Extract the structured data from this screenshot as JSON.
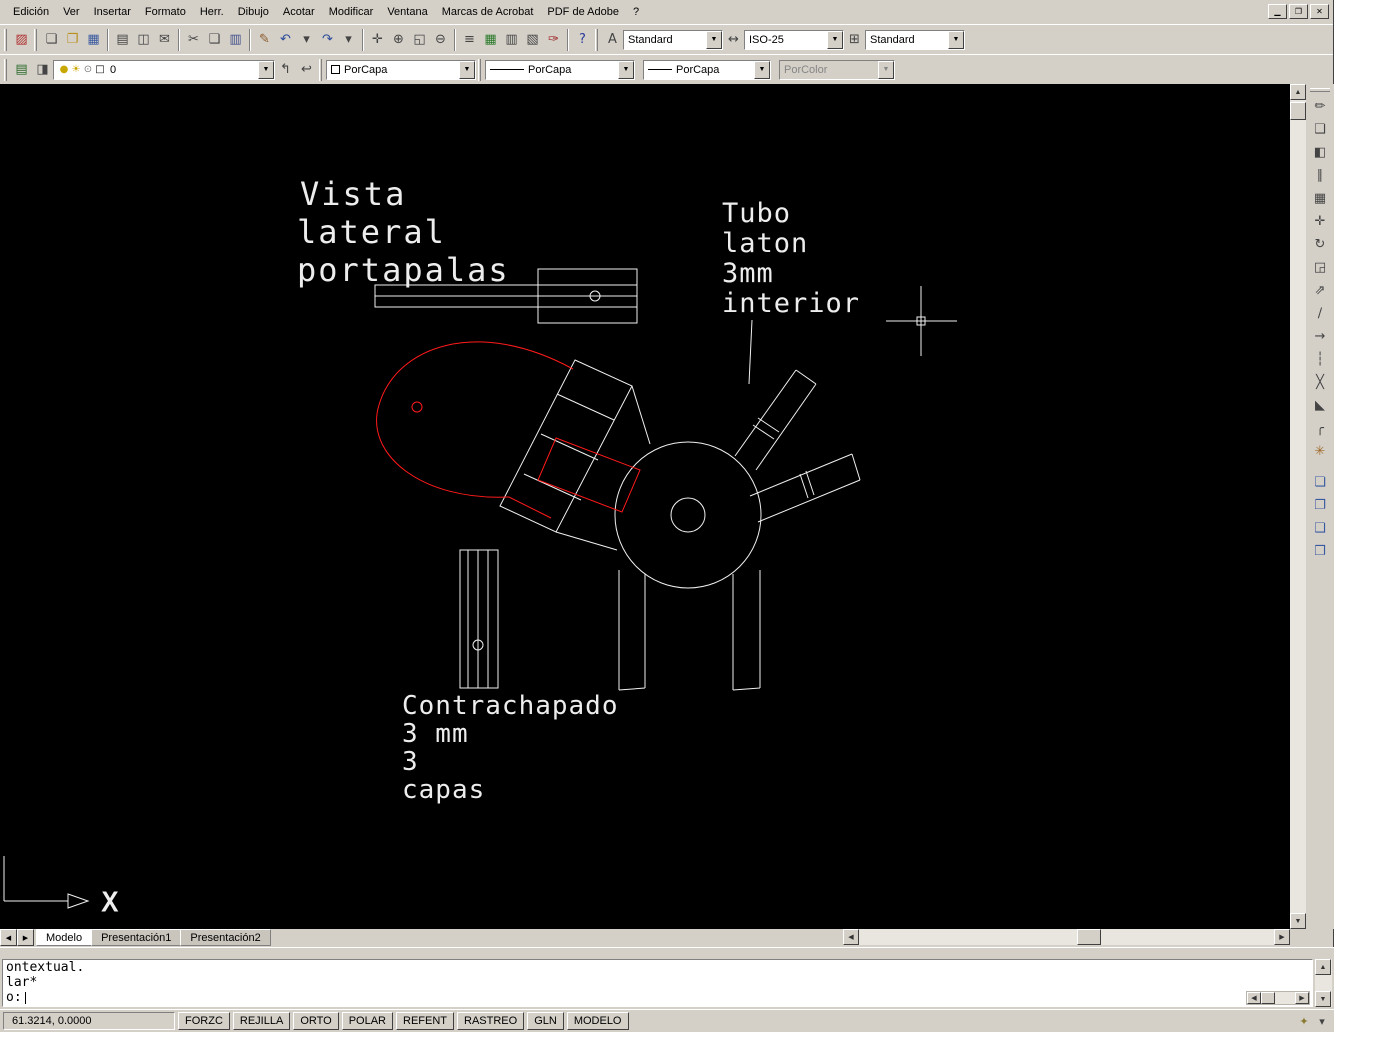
{
  "menu_bar": {
    "items": [
      {
        "name": "menu-edicion",
        "label": "Edición"
      },
      {
        "name": "menu-ver",
        "label": "Ver"
      },
      {
        "name": "menu-insertar",
        "label": "Insertar"
      },
      {
        "name": "menu-formato",
        "label": "Formato"
      },
      {
        "name": "menu-herr",
        "label": "Herr."
      },
      {
        "name": "menu-dibujo",
        "label": "Dibujo"
      },
      {
        "name": "menu-acotar",
        "label": "Acotar"
      },
      {
        "name": "menu-modificar",
        "label": "Modificar"
      },
      {
        "name": "menu-ventana",
        "label": "Ventana"
      },
      {
        "name": "menu-marcas-de-acrobat",
        "label": "Marcas de Acrobat"
      },
      {
        "name": "menu-pdf-de-adobe",
        "label": "PDF de Adobe"
      },
      {
        "name": "menu-ayuda",
        "label": "?"
      }
    ],
    "window_controls": [
      {
        "name": "minimize-button",
        "glyph": "▁"
      },
      {
        "name": "restore-button",
        "glyph": "❐"
      },
      {
        "name": "close-button",
        "glyph": "✕"
      }
    ]
  },
  "toolbar_standard": {
    "groups": [
      [
        {
          "name": "app-icon",
          "glyph": "▨",
          "color": "#b03030"
        }
      ],
      [
        {
          "name": "new-icon",
          "glyph": "❏",
          "color": "#444"
        },
        {
          "name": "open-icon",
          "glyph": "❐",
          "color": "#b8901c"
        },
        {
          "name": "save-icon",
          "glyph": "▦",
          "color": "#3a5aa0"
        }
      ],
      [
        {
          "name": "plot-icon",
          "glyph": "▤",
          "color": "#444"
        },
        {
          "name": "plot-preview-icon",
          "glyph": "◫",
          "color": "#444"
        },
        {
          "name": "publish-icon",
          "glyph": "✉",
          "color": "#444"
        }
      ],
      [
        {
          "name": "cut-icon",
          "glyph": "✂",
          "color": "#444"
        },
        {
          "name": "copy-icon",
          "glyph": "❑",
          "color": "#444"
        },
        {
          "name": "paste-icon",
          "glyph": "▥",
          "color": "#44508a"
        }
      ],
      [
        {
          "name": "match-properties-icon",
          "glyph": "✎",
          "color": "#8a5a2a"
        },
        {
          "name": "undo-icon",
          "glyph": "↶",
          "color": "#2a4a9a"
        },
        {
          "name": "undo-history-arrow-icon",
          "glyph": "▾",
          "color": "#444"
        },
        {
          "name": "redo-icon",
          "glyph": "↷",
          "color": "#2a4a9a"
        },
        {
          "name": "redo-history-arrow-icon",
          "glyph": "▾",
          "color": "#444"
        }
      ],
      [
        {
          "name": "pan-realtime-icon",
          "glyph": "✛",
          "color": "#444"
        },
        {
          "name": "zoom-realtime-icon",
          "glyph": "⊕",
          "color": "#444"
        },
        {
          "name": "zoom-window-icon",
          "glyph": "◱",
          "color": "#444"
        },
        {
          "name": "zoom-previous-icon",
          "glyph": "⊖",
          "color": "#444"
        }
      ],
      [
        {
          "name": "properties-icon",
          "glyph": "≡",
          "color": "#444"
        },
        {
          "name": "designcenter-icon",
          "glyph": "▦",
          "color": "#2a7a2a"
        },
        {
          "name": "tool-palettes-icon",
          "glyph": "▥",
          "color": "#444"
        },
        {
          "name": "sheetset-manager-icon",
          "glyph": "▧",
          "color": "#444"
        },
        {
          "name": "markup-icon",
          "glyph": "✑",
          "color": "#a02a2a"
        }
      ],
      [
        {
          "name": "help-icon",
          "glyph": "?",
          "color": "#2a3a9a"
        }
      ]
    ]
  },
  "toolbar_styles": {
    "icons": [
      {
        "name": "text-style-icon",
        "glyph": "A",
        "color": "#444"
      },
      {
        "name": "dim-style-icon",
        "glyph": "↔",
        "color": "#444"
      },
      {
        "name": "table-style-icon",
        "glyph": "⊞",
        "color": "#444"
      }
    ],
    "text_style_value": "Standard",
    "dim_style_value": "ISO-25",
    "table_style_value": "Standard"
  },
  "toolbar_layers": {
    "pre_icons": [
      {
        "name": "layer-properties-icon",
        "glyph": "▤",
        "color": "#2a6a2a"
      },
      {
        "name": "layer-states-icon",
        "glyph": "◨",
        "color": "#444"
      }
    ],
    "layer_combo": {
      "icons": [
        {
          "name": "layer-on-bulb-icon",
          "glyph": "●",
          "color": "#c8a800"
        },
        {
          "name": "layer-thaw-sun-icon",
          "glyph": "☀",
          "color": "#c8a800"
        },
        {
          "name": "layer-lock-icon",
          "glyph": "⊙",
          "color": "#777"
        },
        {
          "name": "layer-color-swatch-icon",
          "glyph": "□",
          "color": "#000"
        }
      ],
      "value": "0"
    },
    "post_icons": [
      {
        "name": "make-object-layer-current-icon",
        "glyph": "↰",
        "color": "#444"
      },
      {
        "name": "layer-previous-icon",
        "glyph": "↩",
        "color": "#444"
      }
    ],
    "color_value": "PorCapa",
    "linetype_value": "PorCapa",
    "lineweight_value": "PorCapa",
    "plot_style_value": "PorColor"
  },
  "side_toolbar": {
    "modify_icons": [
      {
        "name": "erase-icon",
        "glyph": "✏",
        "color": "#444"
      },
      {
        "name": "copy-object-icon",
        "glyph": "❑",
        "color": "#444"
      },
      {
        "name": "mirror-icon",
        "glyph": "◧",
        "color": "#444"
      },
      {
        "name": "offset-icon",
        "glyph": "∥",
        "color": "#444"
      },
      {
        "name": "array-icon",
        "glyph": "▦",
        "color": "#444"
      },
      {
        "name": "move-icon",
        "glyph": "✛",
        "color": "#444"
      },
      {
        "name": "rotate-icon",
        "glyph": "↻",
        "color": "#444"
      },
      {
        "name": "scale-icon",
        "glyph": "◲",
        "color": "#444"
      },
      {
        "name": "stretch-icon",
        "glyph": "⇗",
        "color": "#444"
      },
      {
        "name": "trim-icon",
        "glyph": "∕",
        "color": "#444"
      },
      {
        "name": "extend-icon",
        "glyph": "→",
        "color": "#444"
      },
      {
        "name": "break-at-point-icon",
        "glyph": "┆",
        "color": "#444"
      },
      {
        "name": "break-icon",
        "glyph": "╳",
        "color": "#444"
      },
      {
        "name": "chamfer-icon",
        "glyph": "◣",
        "color": "#444"
      },
      {
        "name": "fillet-icon",
        "glyph": "╭",
        "color": "#444"
      },
      {
        "name": "explode-icon",
        "glyph": "✳",
        "color": "#a06a2a"
      }
    ],
    "draworder_icons": [
      {
        "name": "bring-to-front-icon",
        "glyph": "❏",
        "color": "#3a5aa0"
      },
      {
        "name": "send-to-back-icon",
        "glyph": "❐",
        "color": "#3a5aa0"
      },
      {
        "name": "bring-above-icon",
        "glyph": "❑",
        "color": "#3a5aa0"
      },
      {
        "name": "send-under-icon",
        "glyph": "❒",
        "color": "#3a5aa0"
      }
    ]
  },
  "ui": {
    "dropdown": "▼",
    "up": "▲",
    "down": "▼",
    "left": "◀",
    "right": "▶"
  },
  "drawing": {
    "labels": {
      "vista": {
        "lines": [
          "Vista",
          "lateral",
          "portapalas"
        ]
      },
      "tubo": {
        "lines": [
          "Tubo",
          "laton",
          "3mm",
          "interior"
        ]
      },
      "contrachapado": {
        "lines": [
          "Contrachapado",
          "3 mm",
          "3",
          "capas"
        ]
      }
    },
    "ucs_x": "X",
    "line_color": "#f0f0f0",
    "highlight_color": "#ff1a1a"
  },
  "tabs": {
    "items": [
      {
        "name": "tab-modelo",
        "label": "Modelo",
        "active": true
      },
      {
        "name": "tab-presentacion1",
        "label": "Presentación1"
      },
      {
        "name": "tab-presentacion2",
        "label": "Presentación2"
      }
    ]
  },
  "command": {
    "lines": [
      "ontextual.",
      "lar*",
      "o:"
    ]
  },
  "status_bar": {
    "coordinates": "61.3214, 0.0000",
    "buttons": [
      {
        "name": "forzc-button",
        "label": "FORZC"
      },
      {
        "name": "rejilla-button",
        "label": "REJILLA"
      },
      {
        "name": "orto-button",
        "label": "ORTO"
      },
      {
        "name": "polar-button",
        "label": "POLAR"
      },
      {
        "name": "refent-button",
        "label": "REFENT"
      },
      {
        "name": "rastreo-button",
        "label": "RASTREO"
      },
      {
        "name": "gln-button",
        "label": "GLN"
      },
      {
        "name": "modelo-button",
        "label": "MODELO"
      }
    ],
    "tray_icons": [
      {
        "name": "communication-center-icon",
        "glyph": "✦",
        "color": "#8a7a30"
      },
      {
        "name": "tray-arrow-icon",
        "glyph": "▾",
        "color": "#444"
      }
    ]
  }
}
